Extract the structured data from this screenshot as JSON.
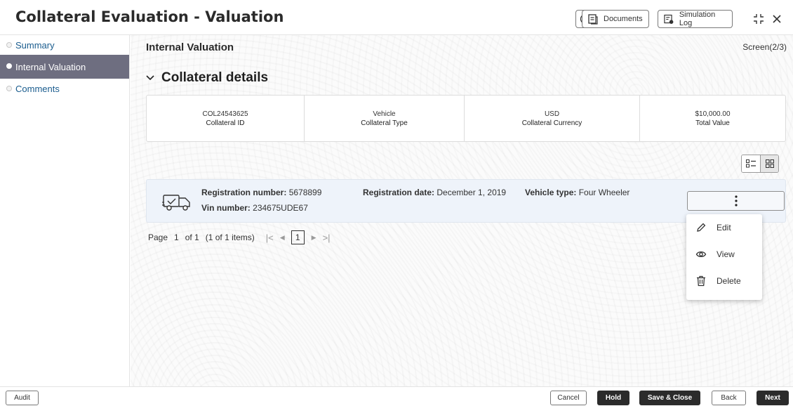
{
  "window": {
    "title": "Collateral Evaluation - Valuation",
    "info_icon": "info-icon",
    "documents_label": "Documents",
    "simulation_log_label": "Simulation Log"
  },
  "sidebar": {
    "items": [
      {
        "label": "Summary",
        "active": false
      },
      {
        "label": "Internal Valuation",
        "active": true
      },
      {
        "label": "Comments",
        "active": false
      }
    ]
  },
  "main": {
    "section_title": "Internal Valuation",
    "screen_indicator": "Screen(2/3)",
    "collateral_details_title": "Collateral details",
    "summary": [
      {
        "value": "COL24543625",
        "label": "Collateral ID"
      },
      {
        "value": "Vehicle",
        "label": "Collateral Type"
      },
      {
        "value": "USD",
        "label": "Collateral Currency"
      },
      {
        "value": "$10,000.00",
        "label": "Total Value"
      }
    ],
    "record": {
      "registration_number_label": "Registration number:",
      "registration_number": "5678899",
      "registration_date_label": "Registration date:",
      "registration_date": "December 1, 2019",
      "vehicle_type_label": "Vehicle type:",
      "vehicle_type": "Four Wheeler",
      "vin_label": "Vin number:",
      "vin": "234675UDE67"
    },
    "pager": {
      "page_label": "Page",
      "page": "1",
      "of_label": "of 1",
      "items_label": "(1 of 1 items)",
      "current_page": "1"
    },
    "context_menu": [
      {
        "label": "Edit",
        "icon": "pencil-icon"
      },
      {
        "label": "View",
        "icon": "eye-icon"
      },
      {
        "label": "Delete",
        "icon": "trash-icon"
      }
    ]
  },
  "footer": {
    "audit": "Audit",
    "cancel": "Cancel",
    "hold": "Hold",
    "save_close": "Save & Close",
    "back": "Back",
    "next": "Next"
  },
  "colors": {
    "sidebar_active_bg": "#6e6e80",
    "link_color": "#1a5c8e",
    "record_bg": "#eef3fa",
    "primary_button": "#2b2b2b"
  }
}
